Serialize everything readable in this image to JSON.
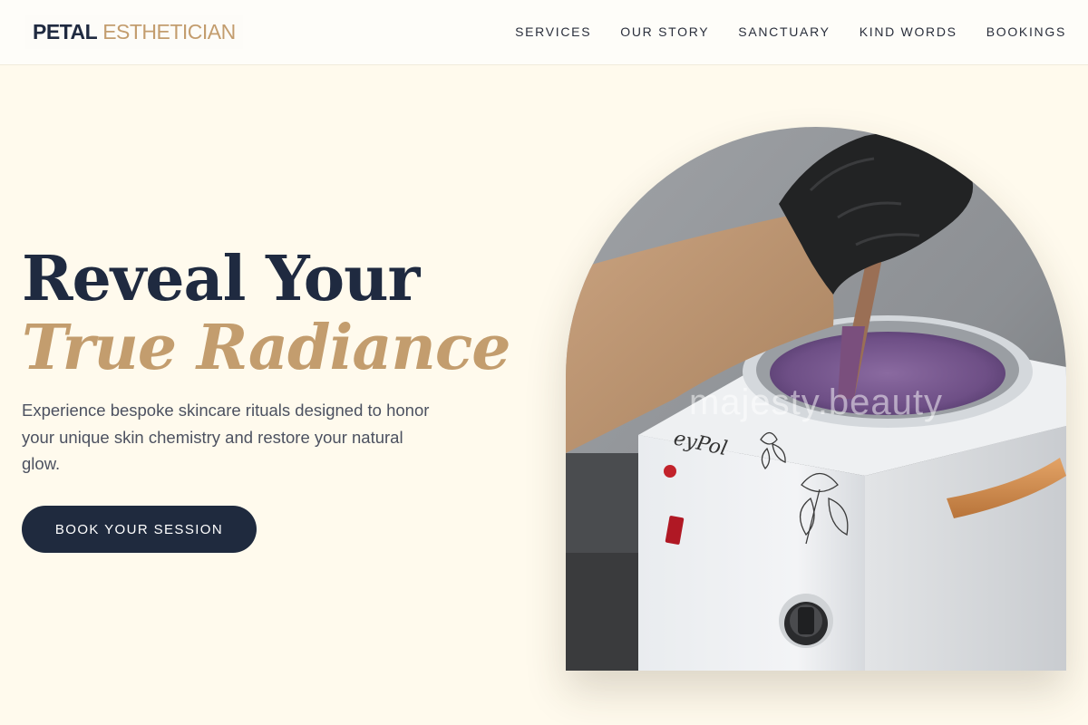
{
  "brand": {
    "name_strong": "PETAL",
    "name_light": "ESTHETICIAN"
  },
  "nav": {
    "items": [
      {
        "label": "SERVICES"
      },
      {
        "label": "OUR STORY"
      },
      {
        "label": "SANCTUARY"
      },
      {
        "label": "KIND WORDS"
      },
      {
        "label": "BOOKINGS"
      }
    ]
  },
  "hero": {
    "title_line1": "Reveal Your",
    "title_line2": "True Radiance",
    "description": "Experience bespoke skincare rituals designed to honor your unique skin chemistry and restore your natural glow.",
    "cta_label": "BOOK YOUR SESSION",
    "image_watermark": "majesty.beauty"
  },
  "colors": {
    "background": "#fffaed",
    "navy": "#1f2a40",
    "gold": "#c39d6e",
    "body_text": "#4c5160"
  }
}
